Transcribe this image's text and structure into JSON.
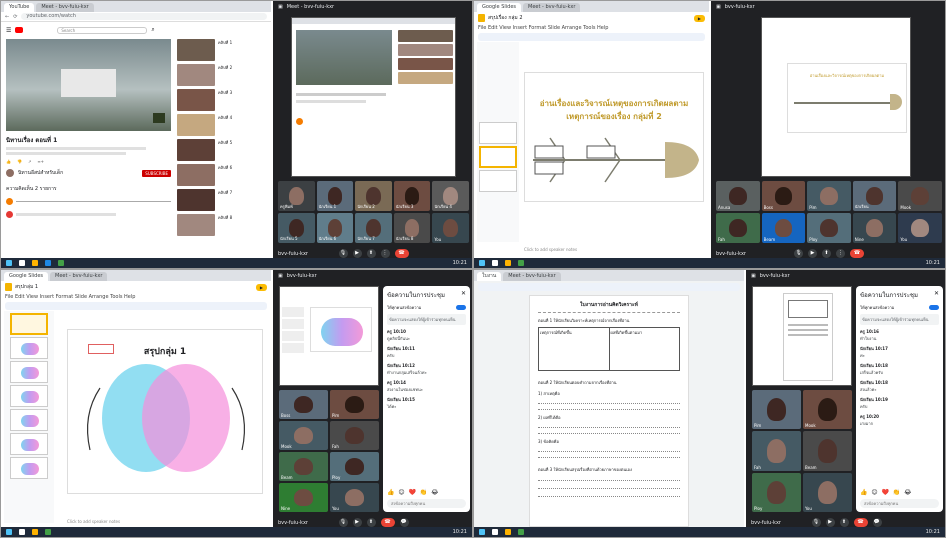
{
  "taskbar": {
    "clock": "10:21"
  },
  "q1": {
    "tabs": [
      "YouTube",
      "Meet - bvv-fuiu-kxr"
    ],
    "url": "youtube.com/watch",
    "yt_search": "Search",
    "video_title": "นิทานเรื่อง ตอนที่ 1",
    "channel": "นิทานอีสปสำหรับเด็ก",
    "subscribe": "SUBSCRIBE",
    "comment_count": "ความคิดเห็น 2 รายการ",
    "sidebar_titles": [
      "คลิปที่ 1",
      "คลิปที่ 2",
      "คลิปที่ 3",
      "คลิปที่ 4",
      "คลิปที่ 5",
      "คลิปที่ 6",
      "คลิปที่ 7",
      "คลิปที่ 8"
    ],
    "meet_title": "Meet - bvv-fuiu-kxr",
    "meet_id": "bvv-fuiu-kxr",
    "tiles": [
      "ครูพิมพ์",
      "นักเรียน 1",
      "นักเรียน 2",
      "นักเรียน 3",
      "นักเรียน 4",
      "นักเรียน 5",
      "นักเรียน 6",
      "นักเรียน 7",
      "นักเรียน 8",
      "You"
    ]
  },
  "q2": {
    "tabs": [
      "Google Slides",
      "Meet - bvv-fuiu-kxr"
    ],
    "doc_title": "สรุปเรื่อง กลุ่ม 2",
    "menu": "File  Edit  View  Insert  Format  Slide  Arrange  Tools  Help",
    "slide_heading": "อ่านเรื่องและวิจารณ์เหตุของการเกิดผลตาม",
    "slide_subheading": "เหตุการณ์ของเรื่อง กลุ่มที่ 2",
    "notes": "Click to add speaker notes",
    "meet_id": "bvv-fuiu-kxr",
    "tiles": [
      "Anusa",
      "Boss",
      "Pim",
      "นักเรียน",
      "Mook",
      "Fah",
      "Beam",
      "Ploy",
      "Nine",
      "You"
    ]
  },
  "q3": {
    "tabs": [
      "Google Slides",
      "Meet - bvv-fuiu-kxr"
    ],
    "doc_title": "สรุปกลุ่ม 1",
    "menu": "File  Edit  View  Insert  Format  Slide  Arrange  Tools  Help",
    "slide_heading": "สรุปกลุ่ม 1",
    "notes": "Click to add speaker notes",
    "chat_title": "ข้อความในการประชุม",
    "chat_toggle_label": "ให้ทุกคนส่งข้อความ",
    "chat_note": "ข้อความจะแสดงให้ผู้เข้าร่วมทุกคนเห็น",
    "messages": [
      {
        "who": "ครู 10:10",
        "text": "ดูคลิปนี้กันนะ"
      },
      {
        "who": "นักเรียน 10:11",
        "text": "ครับ"
      },
      {
        "who": "นักเรียน 10:12",
        "text": "ทำงานกลุ่มเสร็จแล้วค่ะ"
      },
      {
        "who": "ครู 10:14",
        "text": "ส่งงานในช่องแชทนะ"
      },
      {
        "who": "นักเรียน 10:15",
        "text": "ได้ค่ะ"
      }
    ],
    "chat_input": "ส่งข้อความถึงทุกคน",
    "emoji": "👍 😊 ❤️ 👏 😂",
    "meet_id": "bvv-fuiu-kxr",
    "tiles": [
      "Boss",
      "Pim",
      "Mook",
      "Fah",
      "Beam",
      "Ploy",
      "Nine",
      "You"
    ]
  },
  "q4": {
    "tabs": [
      "ใบงาน",
      "Meet - bvv-fuiu-kxr"
    ],
    "doc_heading": "ใบงานการอ่านคิดวิเคราะห์",
    "section1": "ตอนที่ 1 ให้นักเรียนวิเคราะห์เหตุการณ์จากเรื่องที่อ่าน",
    "col_a": "เหตุการณ์ที่เกิดขึ้น",
    "col_b": "ผลที่เกิดขึ้นตามมา",
    "section2": "ตอนที่ 2 ให้นักเรียนตอบคำถามจากเรื่องที่อ่าน",
    "q_labels": [
      "1) สาเหตุคือ",
      "2) ผลที่ได้คือ",
      "3) ข้อคิดคือ"
    ],
    "section3": "ตอนที่ 3 ให้นักเรียนสรุปเรื่องที่อ่านด้วยภาษาของตนเอง",
    "chat_title": "ข้อความในการประชุม",
    "chat_toggle_label": "ให้ทุกคนส่งข้อความ",
    "chat_note": "ข้อความจะแสดงให้ผู้เข้าร่วมทุกคนเห็น",
    "messages": [
      {
        "who": "ครู 10:16",
        "text": "ทำใบงาน"
      },
      {
        "who": "นักเรียน 10:17",
        "text": "ค่ะ"
      },
      {
        "who": "นักเรียน 10:18",
        "text": "เสร็จแล้วครับ"
      },
      {
        "who": "นักเรียน 10:18",
        "text": "ส่งแล้วค่ะ"
      },
      {
        "who": "นักเรียน 10:19",
        "text": "ครับ"
      },
      {
        "who": "ครู 10:20",
        "text": "เก่งมาก"
      }
    ],
    "chat_input": "ส่งข้อความถึงทุกคน",
    "emoji": "👍 😊 ❤️ 👏 😂",
    "meet_id": "bvv-fuiu-kxr",
    "tiles": [
      "Pim",
      "Mook",
      "Fah",
      "Beam",
      "Ploy",
      "You"
    ]
  }
}
